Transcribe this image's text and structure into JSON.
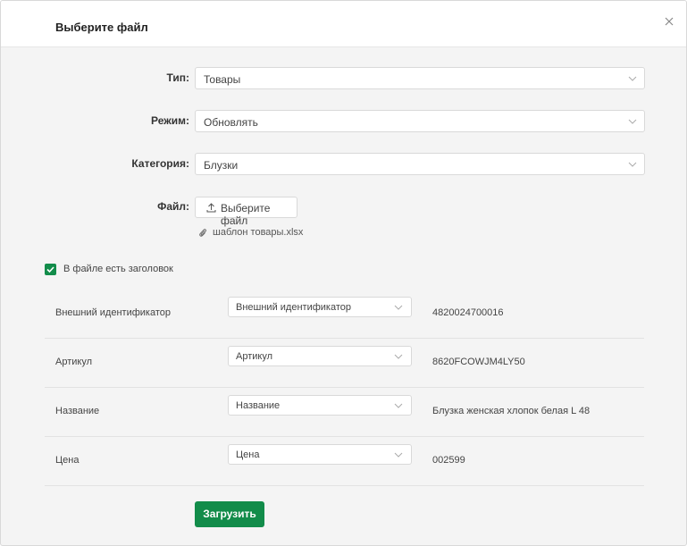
{
  "modal": {
    "title": "Выберите файл"
  },
  "form": {
    "type": {
      "label": "Тип:",
      "value": "Товары"
    },
    "mode": {
      "label": "Режим:",
      "value": "Обновлять"
    },
    "category": {
      "label": "Категория:",
      "value": "Блузки"
    },
    "file": {
      "label": "Файл:",
      "button_label": "Выберите файл",
      "template_link": "шаблон товары.xlsx"
    }
  },
  "header_checkbox": {
    "checked": true,
    "label": "В файле есть заголовок"
  },
  "mapping": [
    {
      "field": "Внешний идентификатор",
      "column": "Внешний идентификатор",
      "sample": "4820024700016"
    },
    {
      "field": "Артикул",
      "column": "Артикул",
      "sample": "8620FCOWJM4LY50"
    },
    {
      "field": "Название",
      "column": "Название",
      "sample": "Блузка женская хлопок белая L 48"
    },
    {
      "field": "Цена",
      "column": "Цена",
      "sample": "002599"
    }
  ],
  "submit_label": "Загрузить",
  "colors": {
    "accent": "#128c4a"
  },
  "icons": {
    "close": "close-icon",
    "chevron": "chevron-down-icon",
    "upload": "upload-icon",
    "paperclip": "paperclip-icon",
    "check": "check-icon"
  }
}
